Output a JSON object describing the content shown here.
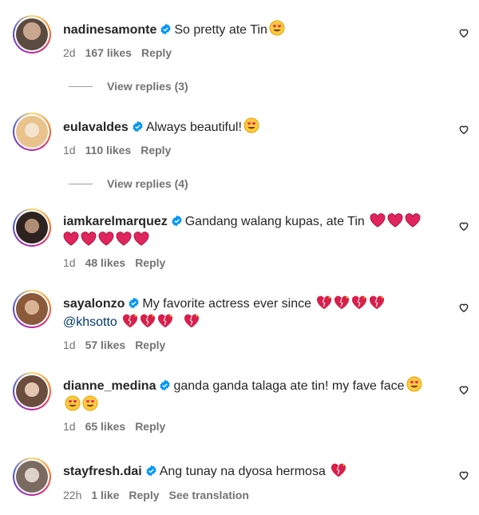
{
  "comments": [
    {
      "username": "nadinesamonte",
      "text": "So pretty ate Tin",
      "emoji_count": 1,
      "emoji_type": "heart-eyes",
      "time": "2d",
      "likes": "167 likes",
      "reply": "Reply",
      "view_replies": "View replies (3)",
      "avatar_colors": [
        "#5b4a3f",
        "#c9a68f"
      ]
    },
    {
      "username": "eulavaldes",
      "text": "Always beautiful!",
      "emoji_count": 1,
      "emoji_type": "heart-eyes",
      "time": "1d",
      "likes": "110 likes",
      "reply": "Reply",
      "view_replies": "View replies (4)",
      "avatar_colors": [
        "#e9c28c",
        "#f3e3cf"
      ]
    },
    {
      "username": "iamkarelmarquez",
      "text": "Gandang walang kupas, ate Tin",
      "line2": "",
      "time": "1d",
      "likes": "48 likes",
      "reply": "Reply",
      "avatar_colors": [
        "#2e2320",
        "#b08c74"
      ]
    },
    {
      "username": "sayalonzo",
      "text": "My favorite actress ever since",
      "mention": "@khsotto",
      "time": "1d",
      "likes": "57 likes",
      "reply": "Reply",
      "avatar_colors": [
        "#8a5a3b",
        "#d9b394"
      ]
    },
    {
      "username": "dianne_medina",
      "text": "ganda ganda talaga ate tin! my fave face",
      "time": "1d",
      "likes": "65 likes",
      "reply": "Reply",
      "avatar_colors": [
        "#6b4d3f",
        "#e3c6b0"
      ]
    },
    {
      "username": "stayfresh.dai",
      "text": "Ang tunay na dyosa hermosa",
      "time": "22h",
      "likes": "1 like",
      "reply": "Reply",
      "see_translation": "See translation",
      "avatar_colors": [
        "#7a6a60",
        "#dcd2c9"
      ]
    }
  ],
  "colors": {
    "verified": "#0095f6",
    "muted": "#737373",
    "heart_red": "#e0245e"
  },
  "icons": {
    "verified": "verified-badge-icon",
    "like": "heart-outline-icon"
  }
}
